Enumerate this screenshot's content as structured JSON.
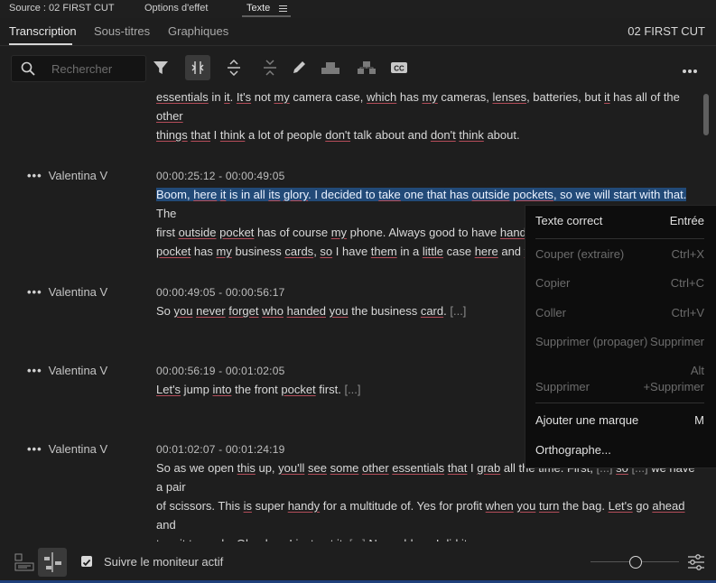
{
  "panel": {
    "source_label": "Source : 02 FIRST CUT",
    "effect_options_label": "Options d'effet",
    "text_label": "Texte",
    "menu_icon": "hamburger-icon"
  },
  "tabs": {
    "transcription": "Transcription",
    "captions": "Sous-titres",
    "graphics": "Graphiques",
    "sequence_name": "02 FIRST CUT"
  },
  "toolbar": {
    "search_placeholder": "Rechercher",
    "icons": [
      "search-icon",
      "filter-icon",
      "split-segment-icon",
      "expand-icon",
      "collapse-icon",
      "pencil-icon",
      "speaker-icon",
      "speaker-network-icon",
      "cc-icon",
      "more-icon"
    ]
  },
  "transcript": {
    "segments": [
      {
        "speaker": "",
        "time": ""
      },
      {
        "speaker": "Valentina V",
        "time": "00:00:25:12 - 00:00:49:05"
      },
      {
        "speaker": "Valentina V",
        "time": "00:00:49:05 - 00:00:56:17"
      },
      {
        "speaker": "Valentina V",
        "time": "00:00:56:19 - 00:01:02:05"
      },
      {
        "speaker": "Valentina V",
        "time": "00:01:02:07 - 00:01:24:19"
      }
    ]
  },
  "context_menu": {
    "items": [
      {
        "label": "Texte correct",
        "shortcut": "Entrée",
        "enabled": true
      },
      {
        "label": "Couper (extraire)",
        "shortcut": "Ctrl+X",
        "enabled": false
      },
      {
        "label": "Copier",
        "shortcut": "Ctrl+C",
        "enabled": false
      },
      {
        "label": "Coller",
        "shortcut": "Ctrl+V",
        "enabled": false
      },
      {
        "label": "Supprimer (propager)",
        "shortcut": "Supprimer",
        "enabled": false
      },
      {
        "label": "Supprimer",
        "shortcut_line1": "Alt",
        "shortcut_line2": "+Supprimer",
        "enabled": false
      },
      {
        "label": "Ajouter une marque",
        "shortcut": "M",
        "enabled": true
      },
      {
        "label": "Orthographe...",
        "shortcut": "",
        "enabled": true
      }
    ]
  },
  "bottom_bar": {
    "follow_label": "Suivre le moniteur actif",
    "follow_checked": true
  },
  "colors": {
    "background": "#1e1e1e",
    "highlight": "#224a78",
    "underline_accent": "#b44d5a",
    "context_menu_bg": "#0d0d0d"
  }
}
